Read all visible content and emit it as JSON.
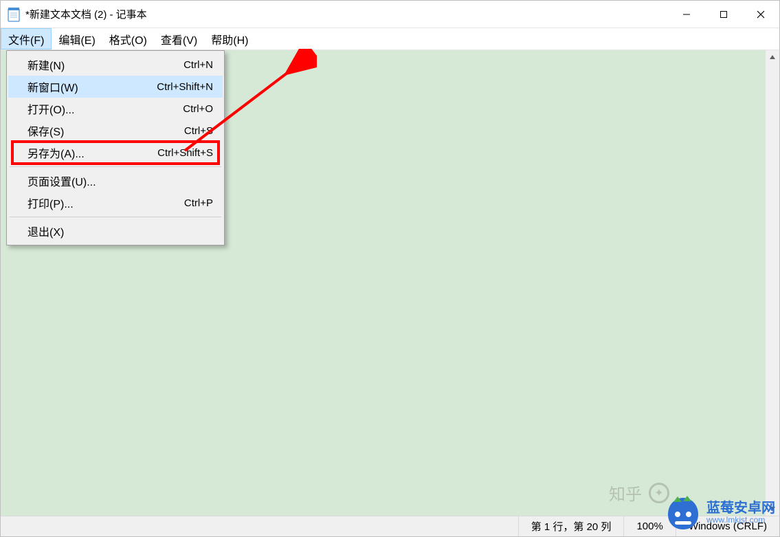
{
  "title": "*新建文本文档 (2) - 记事本",
  "menubar": {
    "file": "文件(F)",
    "edit": "编辑(E)",
    "format": "格式(O)",
    "view": "查看(V)",
    "help": "帮助(H)"
  },
  "file_menu": {
    "new": {
      "label": "新建(N)",
      "shortcut": "Ctrl+N"
    },
    "new_window": {
      "label": "新窗口(W)",
      "shortcut": "Ctrl+Shift+N",
      "hover": true
    },
    "open": {
      "label": "打开(O)...",
      "shortcut": "Ctrl+O"
    },
    "save": {
      "label": "保存(S)",
      "shortcut": "Ctrl+S"
    },
    "save_as": {
      "label": "另存为(A)...",
      "shortcut": "Ctrl+Shift+S",
      "highlight_red": true
    },
    "page_setup": {
      "label": "页面设置(U)..."
    },
    "print": {
      "label": "打印(P)...",
      "shortcut": "Ctrl+P"
    },
    "exit": {
      "label": "退出(X)"
    }
  },
  "statusbar": {
    "position": "第 1 行，第 20 列",
    "zoom": "100%",
    "line_ending": "Windows (CRLF)"
  },
  "watermarks": {
    "zhihu": "知乎",
    "site_name": "蓝莓安卓网",
    "site_url": "www.lmkjst.com"
  },
  "colors": {
    "editor_bg": "#d6e9d6",
    "menu_hover": "#cde8ff",
    "annotation_red": "#ff0000",
    "brand_blue": "#2d6fd2"
  }
}
